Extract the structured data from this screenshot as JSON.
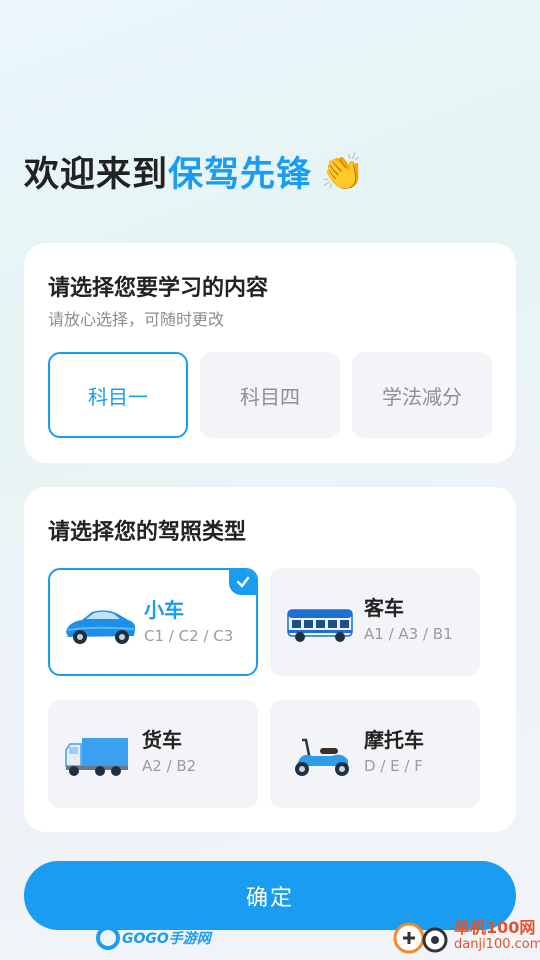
{
  "welcome": {
    "prefix": "欢迎来到",
    "brand": "保驾先锋",
    "emoji": "👏"
  },
  "subject_card": {
    "title": "请选择您要学习的内容",
    "subtitle": "请放心选择，可随时更改",
    "options": [
      {
        "label": "科目一",
        "selected": true
      },
      {
        "label": "科目四",
        "selected": false
      },
      {
        "label": "学法减分",
        "selected": false
      }
    ]
  },
  "license_card": {
    "title": "请选择您的驾照类型",
    "options": [
      {
        "name": "小车",
        "codes": "C1 / C2 / C3",
        "icon": "car-icon",
        "selected": true
      },
      {
        "name": "客车",
        "codes": "A1 / A3 / B1",
        "icon": "bus-icon",
        "selected": false
      },
      {
        "name": "货车",
        "codes": "A2 / B2",
        "icon": "truck-icon",
        "selected": false
      },
      {
        "name": "摩托车",
        "codes": "D / E / F",
        "icon": "scooter-icon",
        "selected": false
      }
    ]
  },
  "confirm_label": "确定",
  "watermarks": {
    "left": "GOGO手游网",
    "right_title": "单机100网",
    "right_url": "danji100.com"
  },
  "colors": {
    "accent": "#1a9cf0",
    "card_bg": "#ffffff",
    "option_bg": "#f3f4f7"
  }
}
